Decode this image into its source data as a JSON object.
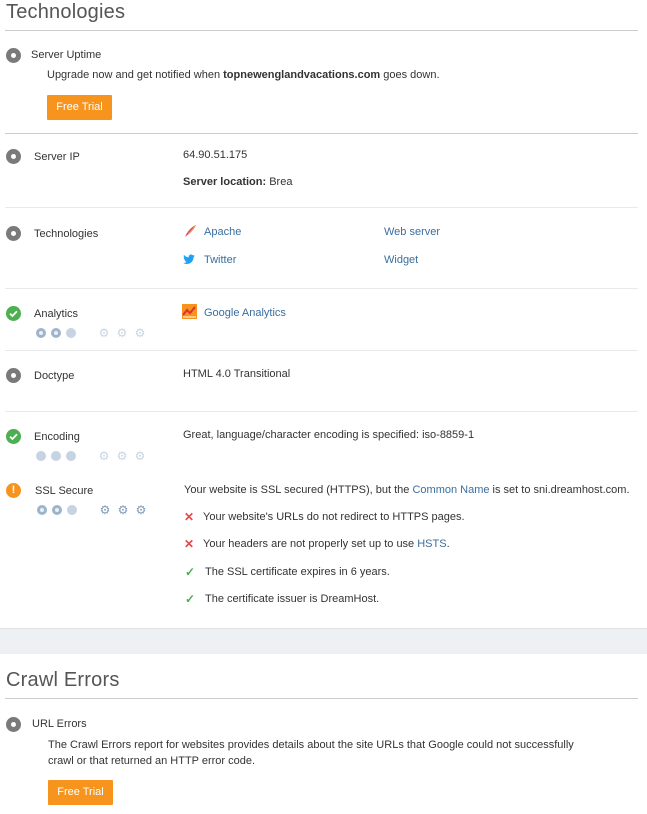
{
  "technologies_section": {
    "title": "Technologies",
    "uptime": {
      "label": "Server Uptime",
      "text_before": "Upgrade now and get notified when ",
      "domain": "topnewenglandvacations.com",
      "text_after": " goes down.",
      "button": "Free Trial"
    },
    "server_ip": {
      "label": "Server IP",
      "ip": "64.90.51.175",
      "location_label": "Server location:",
      "location": "Brea"
    },
    "technologies": {
      "label": "Technologies",
      "items": [
        {
          "name": "Apache",
          "category": "Web server",
          "icon": "feather-icon"
        },
        {
          "name": "Twitter",
          "category": "Widget",
          "icon": "twitter-bird-icon"
        }
      ]
    },
    "analytics": {
      "label": "Analytics",
      "tool": "Google Analytics",
      "rating_circles": 2,
      "rating_gears": 0
    },
    "doctype": {
      "label": "Doctype",
      "value": "HTML 4.0 Transitional"
    },
    "encoding": {
      "label": "Encoding",
      "value": "Great, language/character encoding is specified: iso-8859-1",
      "rating_circles": 0,
      "rating_gears": 0
    },
    "ssl": {
      "label": "SSL Secure",
      "summary_before": "Your website is SSL secured (HTTPS), but the ",
      "summary_link": "Common Name",
      "summary_after": " is set to sni.dreamhost.com.",
      "check1": "Your website's URLs do not redirect to HTTPS pages.",
      "check2_before": "Your headers are not properly set up to use ",
      "check2_link": "HSTS",
      "check2_after": ".",
      "check3": "The SSL certificate expires in 6 years.",
      "check4": "The certificate issuer is DreamHost.",
      "rating_circles": 2,
      "rating_gears": 3
    }
  },
  "crawl_section": {
    "title": "Crawl Errors",
    "url_errors": {
      "label": "URL Errors",
      "line1": "The Crawl Errors report for websites provides details about the site URLs that Google could not successfully",
      "line2": "crawl or that returned an HTTP error code.",
      "button": "Free Trial"
    }
  },
  "colors": {
    "accent_orange": "#f7941d",
    "ok_green": "#4caf50",
    "error_red": "#e14a4a",
    "link_blue": "#3a6e9e"
  }
}
